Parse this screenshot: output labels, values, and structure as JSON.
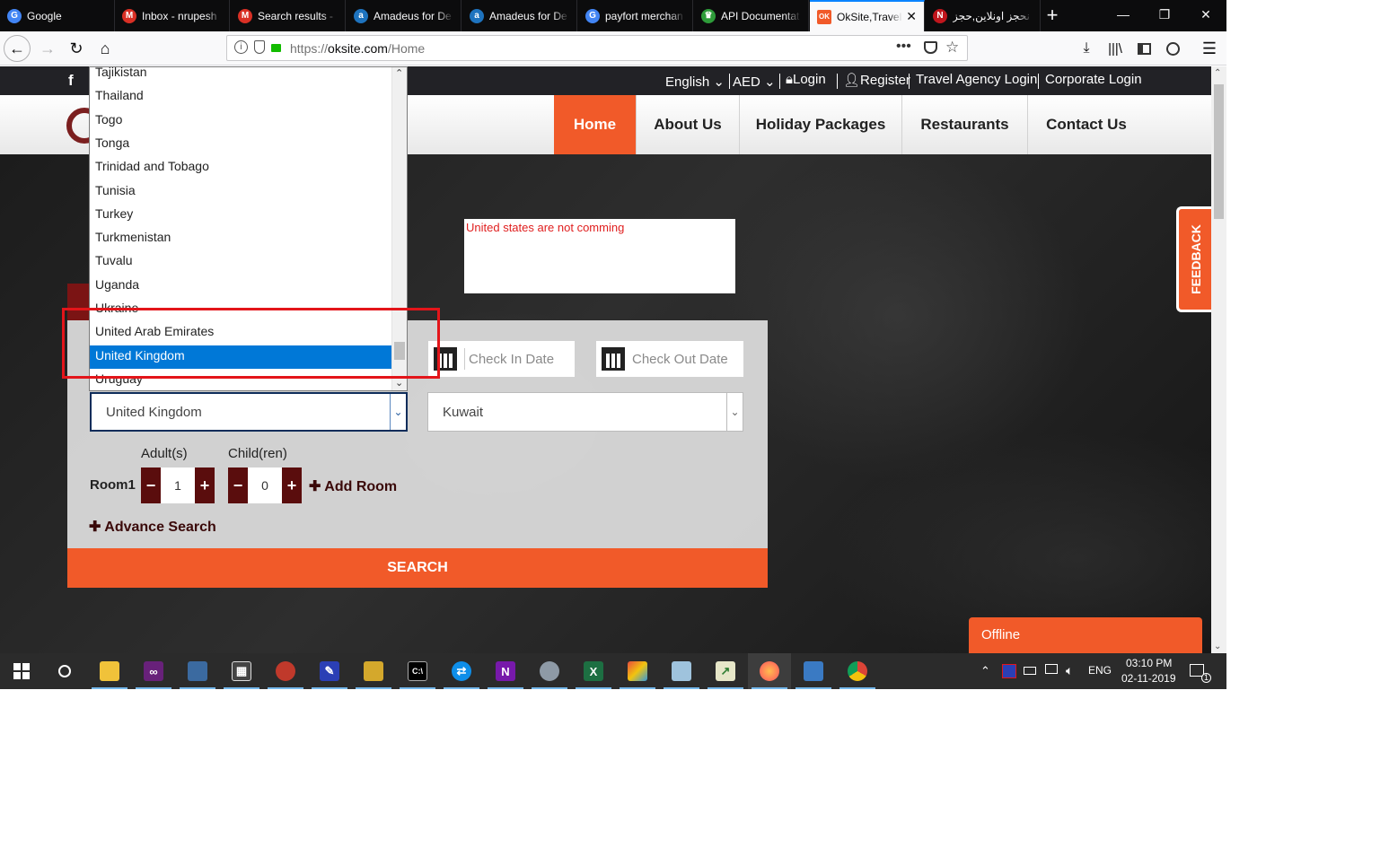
{
  "browser": {
    "tabs": [
      {
        "title": "Google",
        "icon": "google-icon",
        "color": "#4285f4",
        "glyph": "G",
        "active": false
      },
      {
        "title": "Inbox - nrupesh",
        "icon": "gmail-icon",
        "color": "#d93025",
        "glyph": "M",
        "active": false
      },
      {
        "title": "Search results - ",
        "icon": "gmail-icon",
        "color": "#d93025",
        "glyph": "M",
        "active": false
      },
      {
        "title": "Amadeus for De",
        "icon": "amadeus-icon",
        "color": "#1e73be",
        "glyph": "a",
        "active": false
      },
      {
        "title": "Amadeus for De",
        "icon": "amadeus-icon",
        "color": "#1e73be",
        "glyph": "a",
        "active": false
      },
      {
        "title": "payfort merchan",
        "icon": "google-icon",
        "color": "#4285f4",
        "glyph": "G",
        "active": false
      },
      {
        "title": "API Documentat",
        "icon": "crown-icon",
        "color": "#2e9c3a",
        "glyph": "♛",
        "active": false
      },
      {
        "title": "OkSite,Travel",
        "icon": "oksite-icon",
        "color": "#f15a29",
        "glyph": "OK",
        "active": true
      },
      {
        "title": "نحجز اونلاين,حجز",
        "icon": "nahjez-icon",
        "color": "#c0161d",
        "glyph": "N",
        "active": false
      }
    ],
    "url_prefix": "https://",
    "url_host": "oksite.com",
    "url_path": "/Home",
    "new_tab": "+",
    "controls": {
      "minimize": "—",
      "restore": "❐",
      "close": "✕"
    }
  },
  "site": {
    "topbar": {
      "language": "English",
      "currency": "AED",
      "login": "Login",
      "register": "Register",
      "travel_agency_login": "Travel Agency Login",
      "corporate_login": "Corporate Login",
      "facebook": "f"
    },
    "nav": [
      "Home",
      "About Us",
      "Holiday Packages",
      "Restaurants",
      "Contact Us"
    ],
    "notice": "United states are not comming",
    "search": {
      "check_in_placeholder": "Check In Date",
      "check_out_placeholder": "Check Out Date",
      "nationality_value": "United Kingdom",
      "residence_value": "Kuwait",
      "adults_label": "Adult(s)",
      "children_label": "Child(ren)",
      "room_label": "Room1",
      "adults": "1",
      "children": "0",
      "add_room": "Add Room",
      "advance_search": "Advance Search",
      "search_button": "SEARCH",
      "minus": "−",
      "plus": "+"
    },
    "feedback": "FEEDBACK",
    "chat_status": "Offline",
    "accent_color": "#f15a29"
  },
  "country_dropdown": {
    "options": [
      "Tajikistan",
      "Thailand",
      "Togo",
      "Tonga",
      "Trinidad and Tobago",
      "Tunisia",
      "Turkey",
      "Turkmenistan",
      "Tuvalu",
      "Uganda",
      "Ukraine",
      "United Arab Emirates",
      "United Kingdom",
      "Uruguay"
    ],
    "selected": "United Kingdom"
  },
  "taskbar": {
    "language": "ENG",
    "time": "03:10 PM",
    "date": "02-11-2019",
    "notification_count": "1"
  }
}
